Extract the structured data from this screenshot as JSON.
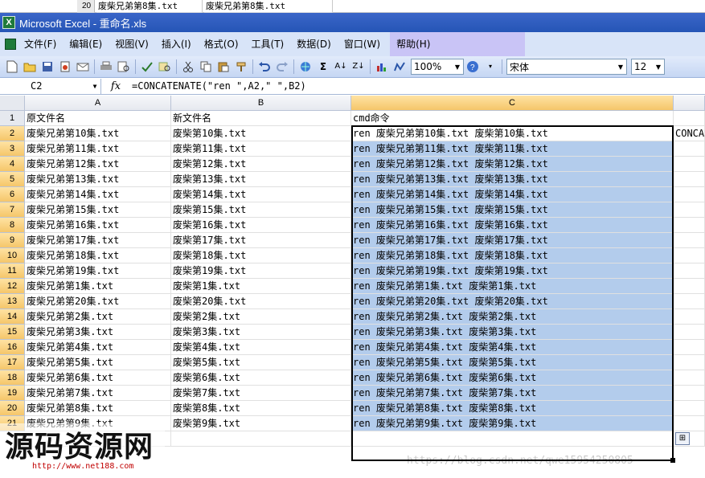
{
  "behind_window": {
    "row_number": "20",
    "cell_a": "废柴兄弟第8集.txt",
    "cell_b": "废柴兄弟第8集.txt"
  },
  "window": {
    "title": "Microsoft Excel - 重命名.xls"
  },
  "menu": {
    "items": [
      "文件(F)",
      "编辑(E)",
      "视图(V)",
      "插入(I)",
      "格式(O)",
      "工具(T)",
      "数据(D)",
      "窗口(W)",
      "帮助(H)"
    ]
  },
  "toolbar": {
    "zoom": "100%",
    "font_name": "宋体",
    "font_size": "12"
  },
  "formula_bar": {
    "name_box": "C2",
    "fx_label": "fx",
    "formula": "=CONCATENATE(\"ren \",A2,\" \",B2)"
  },
  "sheet": {
    "columns": [
      "A",
      "B",
      "C"
    ],
    "active_cell": "C2",
    "header_row": [
      "原文件名",
      "新文件名",
      "cmd命令"
    ],
    "overflow_text_d2": "CONCA",
    "rows": [
      {
        "n": "2",
        "a": "废柴兄弟第10集.txt",
        "b": "废柴第10集.txt",
        "c": "ren 废柴兄弟第10集.txt 废柴第10集.txt"
      },
      {
        "n": "3",
        "a": "废柴兄弟第11集.txt",
        "b": "废柴第11集.txt",
        "c": "ren 废柴兄弟第11集.txt 废柴第11集.txt"
      },
      {
        "n": "4",
        "a": "废柴兄弟第12集.txt",
        "b": "废柴第12集.txt",
        "c": "ren 废柴兄弟第12集.txt 废柴第12集.txt"
      },
      {
        "n": "5",
        "a": "废柴兄弟第13集.txt",
        "b": "废柴第13集.txt",
        "c": "ren 废柴兄弟第13集.txt 废柴第13集.txt"
      },
      {
        "n": "6",
        "a": "废柴兄弟第14集.txt",
        "b": "废柴第14集.txt",
        "c": "ren 废柴兄弟第14集.txt 废柴第14集.txt"
      },
      {
        "n": "7",
        "a": "废柴兄弟第15集.txt",
        "b": "废柴第15集.txt",
        "c": "ren 废柴兄弟第15集.txt 废柴第15集.txt"
      },
      {
        "n": "8",
        "a": "废柴兄弟第16集.txt",
        "b": "废柴第16集.txt",
        "c": "ren 废柴兄弟第16集.txt 废柴第16集.txt"
      },
      {
        "n": "9",
        "a": "废柴兄弟第17集.txt",
        "b": "废柴第17集.txt",
        "c": "ren 废柴兄弟第17集.txt 废柴第17集.txt"
      },
      {
        "n": "10",
        "a": "废柴兄弟第18集.txt",
        "b": "废柴第18集.txt",
        "c": "ren 废柴兄弟第18集.txt 废柴第18集.txt"
      },
      {
        "n": "11",
        "a": "废柴兄弟第19集.txt",
        "b": "废柴第19集.txt",
        "c": "ren 废柴兄弟第19集.txt 废柴第19集.txt"
      },
      {
        "n": "12",
        "a": "废柴兄弟第1集.txt",
        "b": "废柴第1集.txt",
        "c": "ren 废柴兄弟第1集.txt 废柴第1集.txt"
      },
      {
        "n": "13",
        "a": "废柴兄弟第20集.txt",
        "b": "废柴第20集.txt",
        "c": "ren 废柴兄弟第20集.txt 废柴第20集.txt"
      },
      {
        "n": "14",
        "a": "废柴兄弟第2集.txt",
        "b": "废柴第2集.txt",
        "c": "ren 废柴兄弟第2集.txt 废柴第2集.txt"
      },
      {
        "n": "15",
        "a": "废柴兄弟第3集.txt",
        "b": "废柴第3集.txt",
        "c": "ren 废柴兄弟第3集.txt 废柴第3集.txt"
      },
      {
        "n": "16",
        "a": "废柴兄弟第4集.txt",
        "b": "废柴第4集.txt",
        "c": "ren 废柴兄弟第4集.txt 废柴第4集.txt"
      },
      {
        "n": "17",
        "a": "废柴兄弟第5集.txt",
        "b": "废柴第5集.txt",
        "c": "ren 废柴兄弟第5集.txt 废柴第5集.txt"
      },
      {
        "n": "18",
        "a": "废柴兄弟第6集.txt",
        "b": "废柴第6集.txt",
        "c": "ren 废柴兄弟第6集.txt 废柴第6集.txt"
      },
      {
        "n": "19",
        "a": "废柴兄弟第7集.txt",
        "b": "废柴第7集.txt",
        "c": "ren 废柴兄弟第7集.txt 废柴第7集.txt"
      },
      {
        "n": "20",
        "a": "废柴兄弟第8集.txt",
        "b": "废柴第8集.txt",
        "c": "ren 废柴兄弟第8集.txt 废柴第8集.txt"
      },
      {
        "n": "21",
        "a": "废柴兄弟第9集.txt",
        "b": "废柴第9集.txt",
        "c": "ren 废柴兄弟第9集.txt 废柴第9集.txt"
      }
    ]
  },
  "watermarks": {
    "logo_text": "源码资源网",
    "logo_url": "http://www.net188.com",
    "blog_url": "https://blog.csdn.net/qwe15954250805"
  }
}
